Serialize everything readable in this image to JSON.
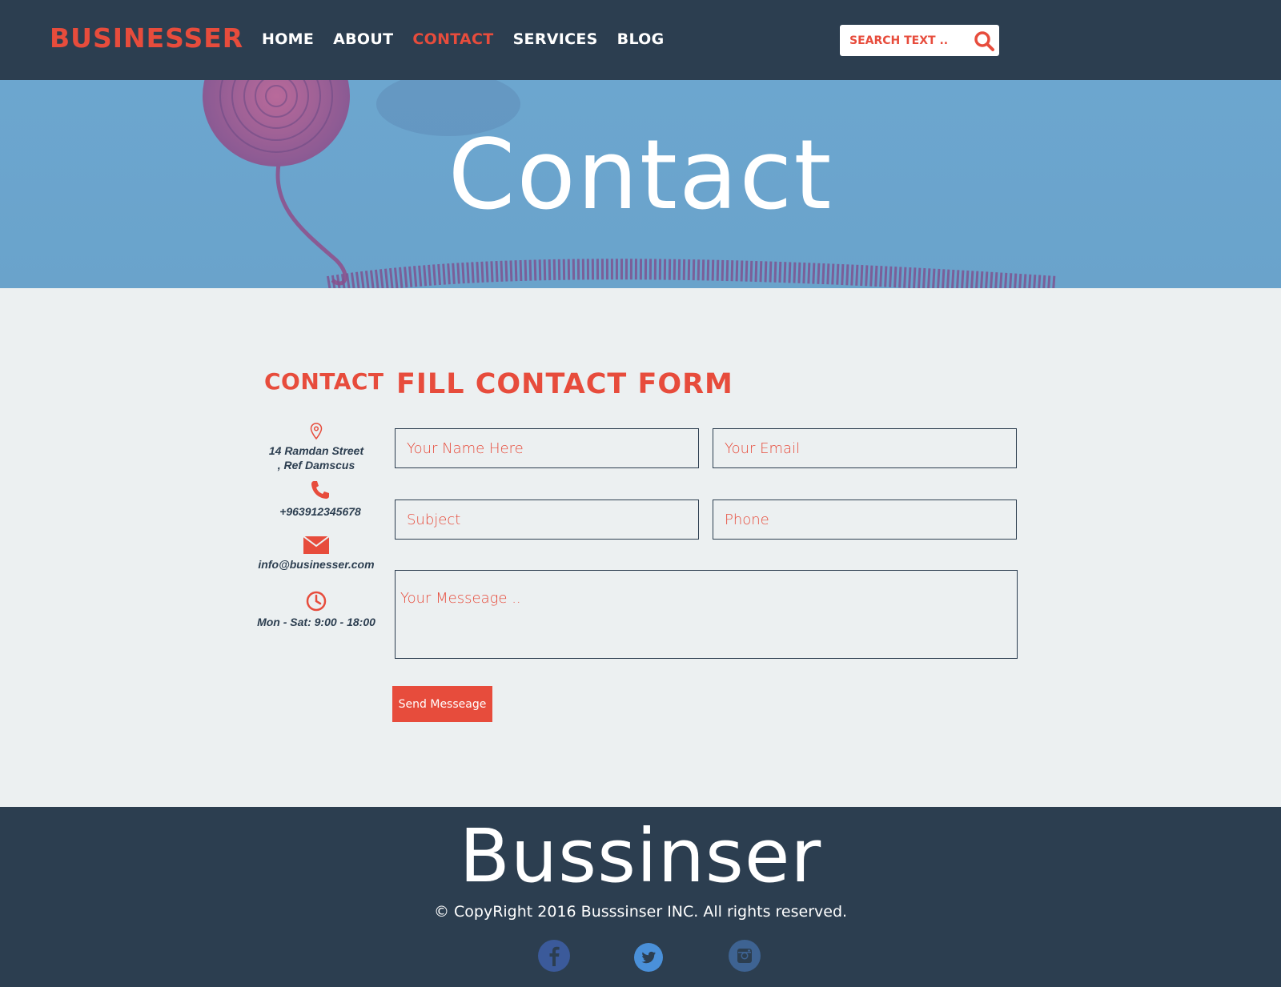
{
  "header": {
    "brand": "BUSINESSER",
    "nav": [
      "HOME",
      "ABOUT",
      "CONTACT",
      "SERVICES",
      "BLOG"
    ],
    "active_nav": "CONTACT",
    "search_placeholder": "SEARCH TEXT .."
  },
  "hero": {
    "title": "Contact"
  },
  "contact_info": {
    "title": "CONTACT",
    "address": "14 Ramdan Street , Ref Damscus",
    "phone": "+963912345678",
    "email": "info@businesser.com",
    "hours": "Mon - Sat: 9:00 - 18:00"
  },
  "form": {
    "title": "FILL CONTACT FORM",
    "name_placeholder": "Your Name Here",
    "email_placeholder": "Your Email",
    "subject_placeholder": "Subject",
    "phone_placeholder": "Phone",
    "message_placeholder": "Your Messeage ..",
    "send_label": "Send Messeage"
  },
  "footer": {
    "brand": "Bussinser",
    "copyright": "© CopyRight 2016 Busssinser INC. All rights reserved.",
    "social": [
      "facebook-icon",
      "twitter-icon",
      "instagram-icon"
    ]
  },
  "colors": {
    "accent": "#e74c3c",
    "dark": "#2c3e50",
    "hero": "#6ca6cf",
    "background": "#ecf0f1"
  }
}
